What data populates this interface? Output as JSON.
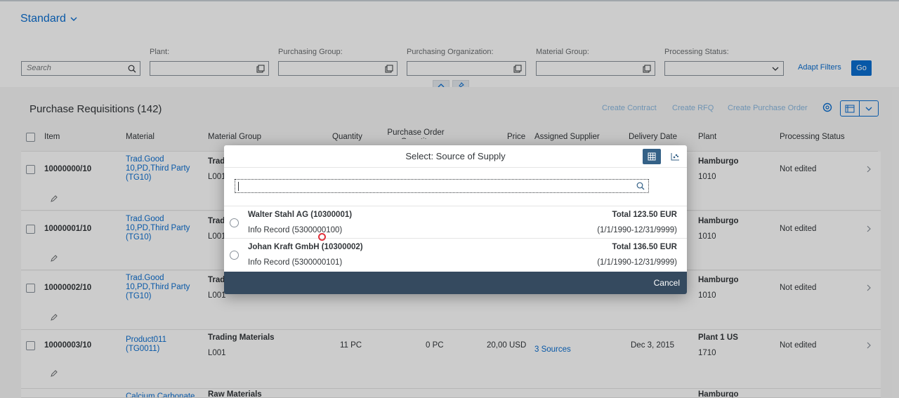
{
  "filterbar": {
    "variant_label": "Standard",
    "search_placeholder": "Search",
    "filters": [
      {
        "label": "Plant:"
      },
      {
        "label": "Purchasing Group:"
      },
      {
        "label": "Purchasing Organization:"
      },
      {
        "label": "Material Group:"
      },
      {
        "label": "Processing Status:"
      }
    ],
    "adapt_filters": "Adapt Filters",
    "go": "Go"
  },
  "table": {
    "title": "Purchase Requisitions (142)",
    "toolbar": {
      "create_contract": "Create Contract",
      "create_rfq": "Create RFQ",
      "create_po": "Create Purchase Order"
    },
    "columns": [
      "Item",
      "Material",
      "Material Group",
      "Quantity",
      "Purchase Order Quantity",
      "Price",
      "Assigned Supplier",
      "Delivery Date",
      "Plant",
      "Processing Status"
    ],
    "rows": [
      {
        "item": "10000000/10",
        "material": [
          "Trad.Good",
          "10,PD,Third Party",
          "(TG10)"
        ],
        "group": "Trad",
        "group_sub": "L001",
        "plant": "Hamburgo",
        "plant_sub": "1010",
        "status": "Not edited"
      },
      {
        "item": "10000001/10",
        "material": [
          "Trad.Good",
          "10,PD,Third Party",
          "(TG10)"
        ],
        "group": "Trad",
        "group_sub": "L001",
        "plant": "Hamburgo",
        "plant_sub": "1010",
        "status": "Not edited"
      },
      {
        "item": "10000002/10",
        "material": [
          "Trad.Good",
          "10,PD,Third Party",
          "(TG10)"
        ],
        "group": "Trad",
        "group_sub": "L001",
        "plant": "Hamburgo",
        "plant_sub": "1010",
        "status": "Not edited"
      },
      {
        "item": "10000003/10",
        "material": [
          "Product011",
          "(TG0011)"
        ],
        "group": "Trading Materials",
        "group_sub": "L001",
        "quantity": "11 PC",
        "po_quantity": "0 PC",
        "price": "20,00 USD",
        "supplier": "3 Sources",
        "delivery": "Dec 3, 2015",
        "plant": "Plant 1 US",
        "plant_sub": "1710",
        "status": "Not edited"
      },
      {
        "material": [
          "Calcium Carbonate"
        ],
        "group": "Raw Materials",
        "plant": "Hamburgo"
      }
    ]
  },
  "dialog": {
    "title": "Select: Source of Supply",
    "items": [
      {
        "title": "Walter Stahl AG (10300001)",
        "sub": "Info Record (5300000100)",
        "total": "Total 123.50 EUR",
        "range": "(1/1/1990-12/31/9999)"
      },
      {
        "title": "Johan Kraft GmbH (10300002)",
        "sub": "Info Record (5300000101)",
        "total": "Total 136.50 EUR",
        "range": "(1/1/1990-12/31/9999)"
      }
    ],
    "cancel": "Cancel"
  },
  "colors": {
    "accent": "#0a6ed1",
    "footer": "#354a5f",
    "segment_active": "#346187"
  },
  "icons": [
    "chevron-down-icon",
    "search-icon",
    "value-help-icon",
    "collapse-icon",
    "pin-icon",
    "settings-icon",
    "export-icon",
    "edit-icon",
    "navigation-icon",
    "table-view-icon",
    "chart-view-icon"
  ]
}
